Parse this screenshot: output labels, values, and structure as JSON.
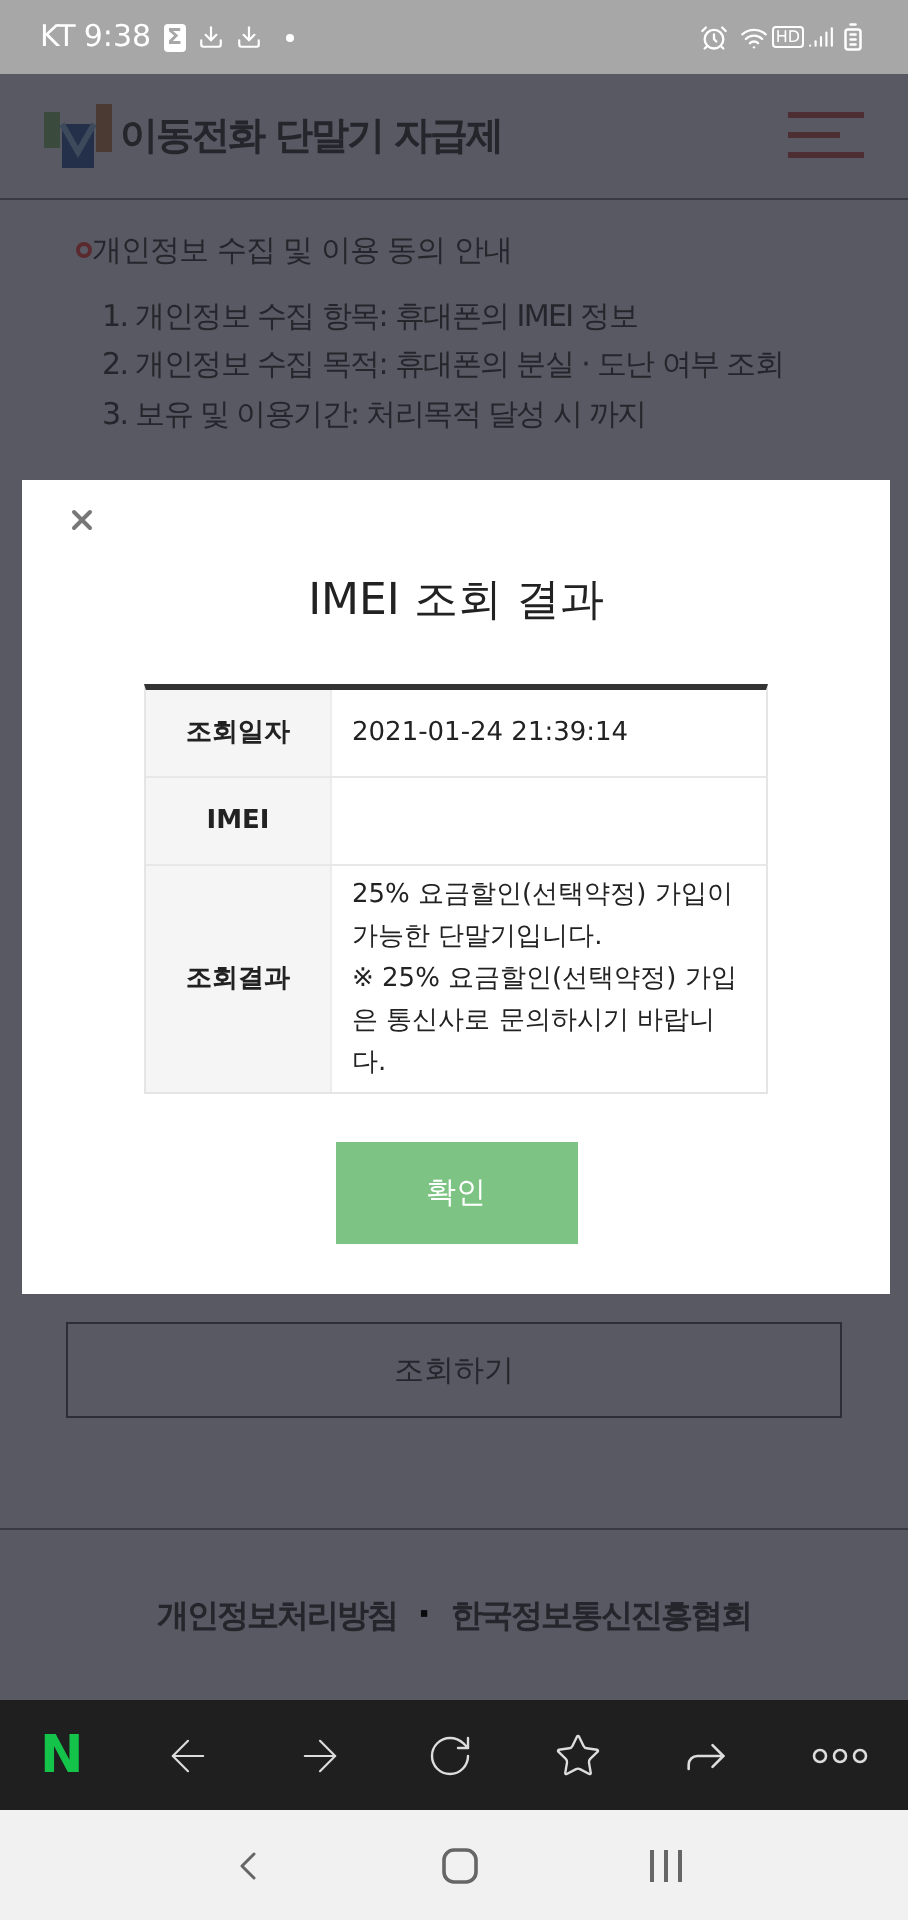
{
  "status_bar": {
    "carrier": "KT",
    "time": "9:38",
    "sigma": "Σ",
    "hd": "HD"
  },
  "header": {
    "site_title": "이동전화 단말기 자급제"
  },
  "notice": {
    "title": "개인정보 수집 및 이용 동의 안내",
    "items": [
      "1. 개인정보 수집 항목: 휴대폰의 IMEI 정보",
      "2. 개인정보 수집 목적: 휴대폰의 분실 · 도난 여부 조회",
      "3. 보유 및 이용기간: 처리목적 달성 시 까지"
    ]
  },
  "search_button": "조회하기",
  "footer": {
    "links": [
      "개인정보처리방침",
      "한국정보통신진흥협회"
    ],
    "separator": "·"
  },
  "modal": {
    "title": "IMEI 조회 결과",
    "rows": [
      {
        "label": "조회일자",
        "value": "2021-01-24 21:39:14"
      },
      {
        "label": "IMEI"
      },
      {
        "label": "조회결과",
        "value": "25% 요금할인(선택약정) 가입이 가능한 단말기입니다.\n※ 25% 요금할인(선택약정) 가입은 통신사로 문의하시기 바랍니다."
      }
    ],
    "confirm_button": "확인"
  },
  "browser_toolbar": {
    "logo": "N"
  }
}
